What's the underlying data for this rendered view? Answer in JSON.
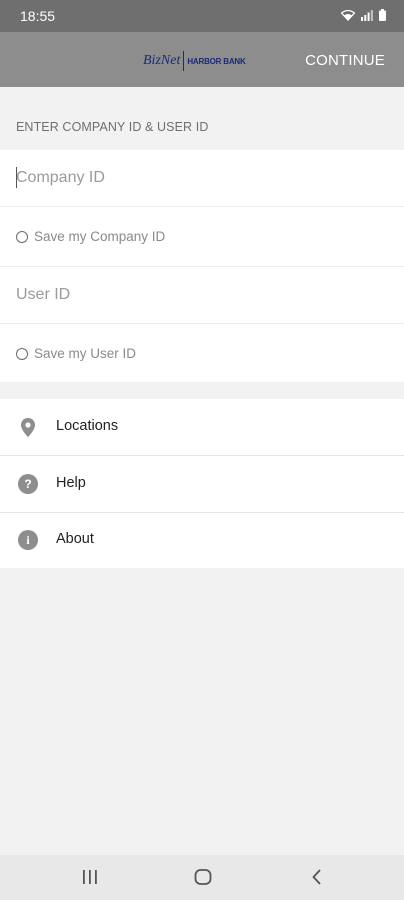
{
  "status_bar": {
    "time": "18:55"
  },
  "app_bar": {
    "logo_biznet": "BizNet",
    "logo_bank": "HARBOR BANK",
    "continue_label": "CONTINUE"
  },
  "form": {
    "section_header": "ENTER COMPANY ID & USER ID",
    "company_id_placeholder": "Company ID",
    "save_company_label": "Save my Company ID",
    "user_id_placeholder": "User ID",
    "save_user_label": "Save my User ID"
  },
  "menu": {
    "items": [
      {
        "label": "Locations",
        "icon": "location-pin-icon"
      },
      {
        "label": "Help",
        "icon": "help-icon"
      },
      {
        "label": "About",
        "icon": "info-icon"
      }
    ]
  },
  "colors": {
    "app_bar": "#8d8d8d",
    "status_bar": "#6f6f6f",
    "logo": "#1b2a78",
    "background": "#f2f2f2"
  }
}
